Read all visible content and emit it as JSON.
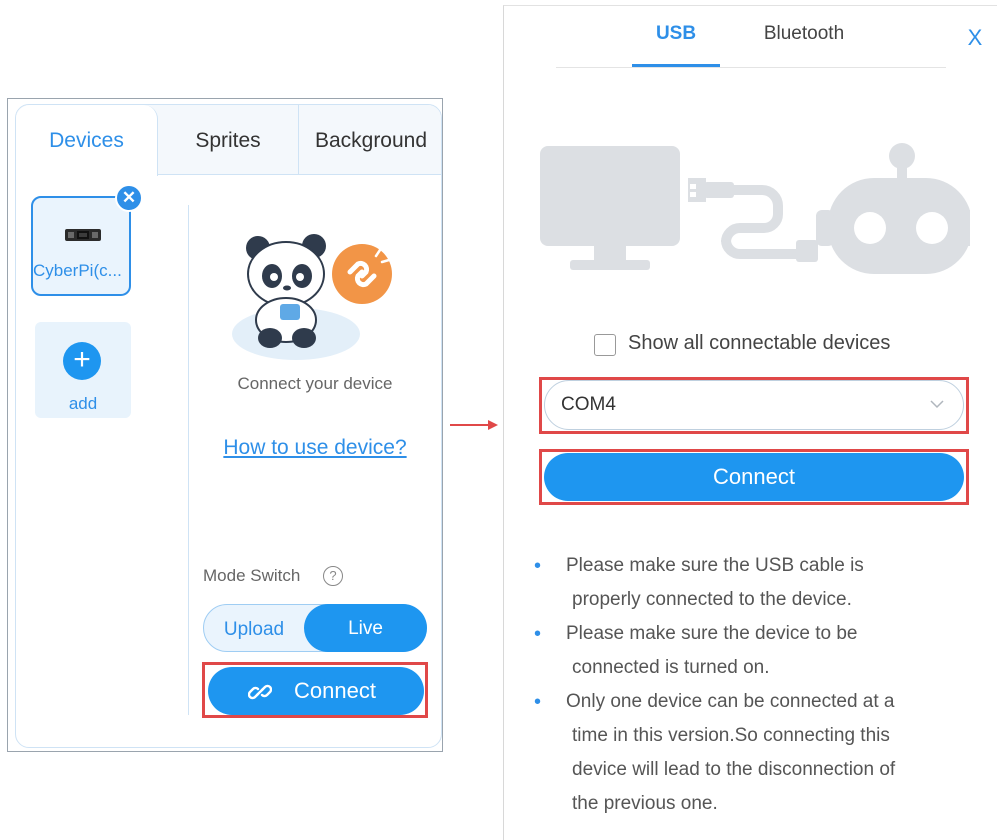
{
  "left_panel": {
    "tabs": [
      {
        "label": "Devices",
        "active": true
      },
      {
        "label": "Sprites",
        "active": false
      },
      {
        "label": "Background",
        "active": false
      }
    ],
    "device_card": {
      "name": "CyberPi(c...",
      "remove_icon": "close-icon"
    },
    "add_card": {
      "icon": "plus-icon",
      "label": "add"
    },
    "status_text": "Connect your device",
    "help_link": "How to use device?",
    "mode_switch": {
      "label": "Mode Switch",
      "help_icon": "?",
      "options": [
        "Upload",
        "Live"
      ],
      "selected": "Live"
    },
    "connect_button": {
      "icon": "link-icon",
      "label": "Connect"
    }
  },
  "right_panel": {
    "tabs": [
      {
        "label": "USB",
        "active": true
      },
      {
        "label": "Bluetooth",
        "active": false
      }
    ],
    "close_icon": "X",
    "show_all": {
      "label": "Show all connectable devices",
      "checked": false
    },
    "port_select": {
      "value": "COM4"
    },
    "connect_button": {
      "label": "Connect"
    },
    "tips": [
      {
        "first": "Please make sure the USB cable is",
        "rest": [
          "properly connected to the device."
        ]
      },
      {
        "first": "Please make sure the device to be",
        "rest": [
          "connected is turned on."
        ]
      },
      {
        "first": "Only one device can be connected at a",
        "rest": [
          "time in this version.So connecting this",
          "device will lead to the disconnection of",
          "the previous one."
        ]
      }
    ]
  },
  "colors": {
    "accent": "#2e8fe8",
    "button_blue": "#1e96f0",
    "highlight_red": "#e04848",
    "illustration_gray": "#dcdfe3"
  }
}
